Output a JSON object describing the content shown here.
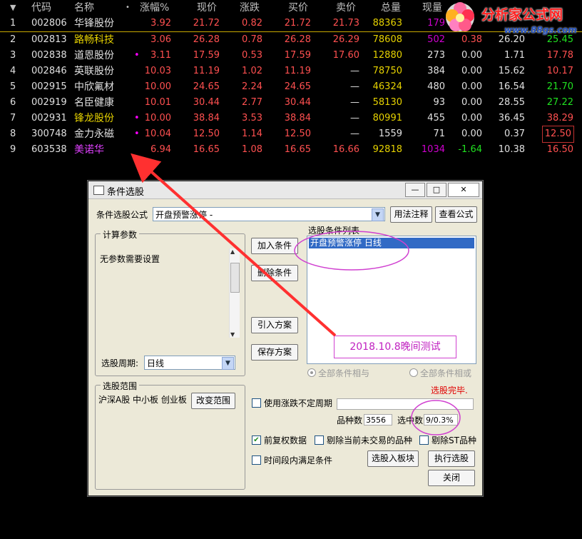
{
  "table": {
    "headers": {
      "sort_icon": "▼",
      "code": "代码",
      "name": "名称",
      "dot": "•",
      "change_pct": "涨幅%",
      "price": "现价",
      "change": "涨跌",
      "bid": "买价",
      "ask": "卖价",
      "volume": "总量",
      "last_vol": "现量"
    },
    "rows": [
      {
        "idx": "1",
        "code": "002806",
        "name": "华锋股份",
        "dot": "",
        "pct": "3.92",
        "price": "21.72",
        "chg": "0.82",
        "bid": "21.72",
        "ask": "21.73",
        "vol": "88363",
        "cur": "179",
        "c8": "",
        "c9": "",
        "c10": ""
      },
      {
        "idx": "2",
        "code": "002813",
        "name": "路畅科技",
        "dot": "",
        "pct": "3.06",
        "price": "26.28",
        "chg": "0.78",
        "bid": "26.28",
        "ask": "26.29",
        "vol": "78608",
        "cur": "502",
        "c8": "0.38",
        "c9": "26.20",
        "c10": "25.45"
      },
      {
        "idx": "3",
        "code": "002838",
        "name": "道恩股份",
        "dot": "•",
        "pct": "3.11",
        "price": "17.59",
        "chg": "0.53",
        "bid": "17.59",
        "ask": "17.60",
        "vol": "12880",
        "cur": "273",
        "c8": "0.00",
        "c9": "1.71",
        "c10": "17.78"
      },
      {
        "idx": "4",
        "code": "002846",
        "name": "英联股份",
        "dot": "",
        "pct": "10.03",
        "price": "11.19",
        "chg": "1.02",
        "bid": "11.19",
        "ask": "—",
        "vol": "78750",
        "cur": "384",
        "c8": "0.00",
        "c9": "15.62",
        "c10": "10.17"
      },
      {
        "idx": "5",
        "code": "002915",
        "name": "中欣氟材",
        "dot": "",
        "pct": "10.00",
        "price": "24.65",
        "chg": "2.24",
        "bid": "24.65",
        "ask": "—",
        "vol": "46324",
        "cur": "480",
        "c8": "0.00",
        "c9": "16.54",
        "c10": "21.70"
      },
      {
        "idx": "6",
        "code": "002919",
        "name": "名臣健康",
        "dot": "",
        "pct": "10.01",
        "price": "30.44",
        "chg": "2.77",
        "bid": "30.44",
        "ask": "—",
        "vol": "58130",
        "cur": "93",
        "c8": "0.00",
        "c9": "28.55",
        "c10": "27.22"
      },
      {
        "idx": "7",
        "code": "002931",
        "name": "锋龙股份",
        "dot": "•",
        "pct": "10.00",
        "price": "38.84",
        "chg": "3.53",
        "bid": "38.84",
        "ask": "—",
        "vol": "80991",
        "cur": "455",
        "c8": "0.00",
        "c9": "36.45",
        "c10": "38.29"
      },
      {
        "idx": "8",
        "code": "300748",
        "name": "金力永磁",
        "dot": "•",
        "pct": "10.04",
        "price": "12.50",
        "chg": "1.14",
        "bid": "12.50",
        "ask": "—",
        "vol": "1559",
        "cur": "71",
        "c8": "0.00",
        "c9": "0.37",
        "c10": "12.50"
      },
      {
        "idx": "9",
        "code": "603538",
        "name": "美诺华",
        "dot": "",
        "pct": "6.94",
        "price": "16.65",
        "chg": "1.08",
        "bid": "16.65",
        "ask": "16.66",
        "vol": "92818",
        "cur": "1034",
        "c8": "-1.64",
        "c9": "10.38",
        "c10": "16.50"
      }
    ]
  },
  "watermark": {
    "title": "分析家公式网",
    "url": "www.88gs.com",
    "partial_header": "现量"
  },
  "dialog": {
    "title": "条件选股",
    "window_buttons": {
      "minimize": "—",
      "maximize": "□",
      "close": "✕"
    },
    "formula_label": "条件选股公式",
    "formula_value": "开盘预警涨停 -",
    "usage_button": "用法注释",
    "view_button": "查看公式",
    "params_group": "计算参数",
    "params_text": "无参数需要设置",
    "period_label": "选股周期:",
    "period_value": "日线",
    "add_button": "加入条件",
    "delete_button": "删除条件",
    "import_button": "引入方案",
    "save_button": "保存方案",
    "list_label": "选股条件列表",
    "list_item": "开盘预警涨停  日线",
    "radio_and": "全部条件相与",
    "radio_or": "全部条件相或",
    "scope_group": "选股范围",
    "scope_text": "沪深A股 中小板 创业板",
    "scope_button": "改变范围",
    "status": "选股完毕.",
    "use_period_label": "使用涨跌不定周期",
    "count_label": "品种数",
    "count_value": "3556",
    "selected_label": "选中数",
    "selected_value": "9/0.3%",
    "adjusted_label": "前复权数据",
    "exclude_untraded_label": "剔除当前未交易的品种",
    "exclude_st_label": "剔除ST品种",
    "time_range_label": "时间段内满足条件",
    "to_block_button": "选股入板块",
    "execute_button": "执行选股",
    "close_button": "关闭"
  },
  "annotation": {
    "note": "2018.10.8晚间测试"
  },
  "colors": {
    "accent_red": "#ff3030",
    "magenta": "#e040ff",
    "highlight": "#316ac5"
  }
}
